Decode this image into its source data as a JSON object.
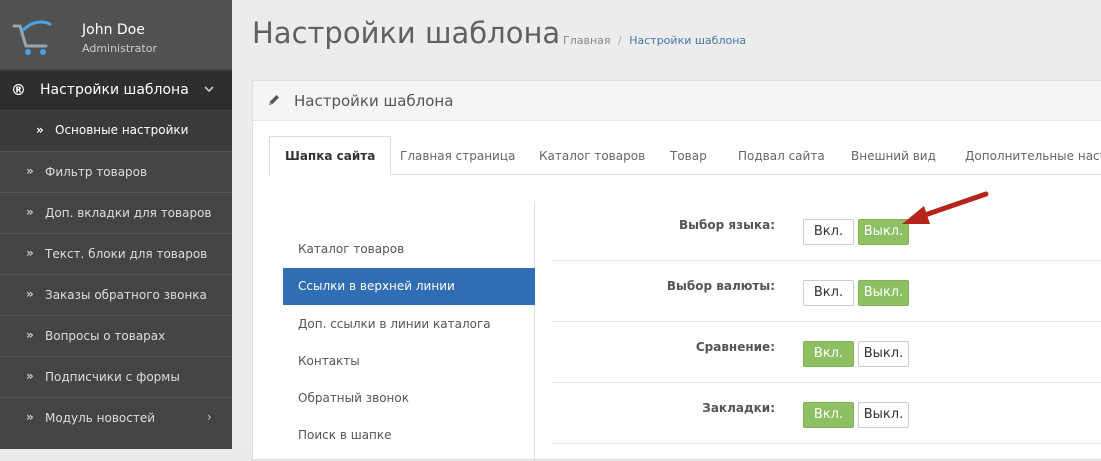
{
  "user": {
    "name": "John Doe",
    "role": "Administrator"
  },
  "sidebar": {
    "main_label": "Настройки шаблона",
    "active_sub": "Основные настройки",
    "items": [
      {
        "label": "Фильтр товаров"
      },
      {
        "label": "Доп. вкладки для товаров"
      },
      {
        "label": "Текст. блоки для товаров"
      },
      {
        "label": "Заказы обратного звонка"
      },
      {
        "label": "Вопросы о товарах"
      },
      {
        "label": "Подписчики с формы"
      },
      {
        "label": "Модуль новостей"
      }
    ]
  },
  "header": {
    "title": "Настройки шаблона",
    "breadcrumb": {
      "home": "Главная",
      "separator": "/",
      "current": "Настройки шаблона"
    }
  },
  "panel": {
    "title": "Настройки шаблона",
    "tabs": [
      {
        "label": "Шапка сайта"
      },
      {
        "label": "Главная страница"
      },
      {
        "label": "Каталог товаров"
      },
      {
        "label": "Товар"
      },
      {
        "label": "Подвал сайта"
      },
      {
        "label": "Внешний вид"
      },
      {
        "label": "Дополнительные настр"
      }
    ],
    "active_tab": "Шапка сайта",
    "side_menu": [
      {
        "label": "Каталог товаров"
      },
      {
        "label": "Ссылки в верхней линии"
      },
      {
        "label": "Доп. ссылки в линии каталога"
      },
      {
        "label": "Контакты"
      },
      {
        "label": "Обратный звонок"
      },
      {
        "label": "Поиск в шапке"
      }
    ],
    "active_side": "Ссылки в верхней линии",
    "settings": [
      {
        "label": "Выбор языка:",
        "on_label": "Вкл.",
        "off_label": "Выкл.",
        "state": "off"
      },
      {
        "label": "Выбор валюты:",
        "on_label": "Вкл.",
        "off_label": "Выкл.",
        "state": "off"
      },
      {
        "label": "Сравнение:",
        "on_label": "Вкл.",
        "off_label": "Выкл.",
        "state": "on"
      },
      {
        "label": "Закладки:",
        "on_label": "Вкл.",
        "off_label": "Выкл.",
        "state": "on"
      }
    ]
  },
  "colors": {
    "sidebar_bg": "#444444",
    "active_blue": "#2f6db5",
    "toggle_green": "#8cc063",
    "annotation_red": "#b5241b"
  }
}
